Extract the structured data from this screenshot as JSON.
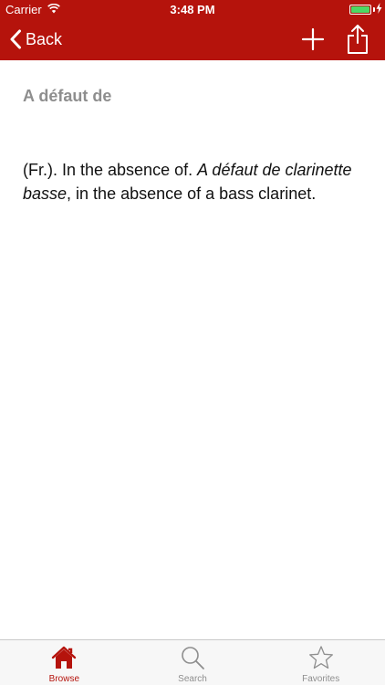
{
  "status_bar": {
    "carrier": "Carrier",
    "time": "3:48 PM"
  },
  "nav": {
    "back_label": "Back"
  },
  "content": {
    "term": "A défaut de",
    "definition": {
      "part1": "(Fr.). In the absence of. ",
      "italic": "A défaut de clarinette basse",
      "part2": ", in the absence of a bass clarinet."
    }
  },
  "tab_bar": {
    "tabs": [
      {
        "label": "Browse",
        "icon": "home-icon",
        "active": true
      },
      {
        "label": "Search",
        "icon": "search-icon",
        "active": false
      },
      {
        "label": "Favorites",
        "icon": "star-icon",
        "active": false
      }
    ]
  },
  "colors": {
    "brand": "#b5130c",
    "battery": "#4cd964",
    "inactive": "#8e8e8e"
  }
}
